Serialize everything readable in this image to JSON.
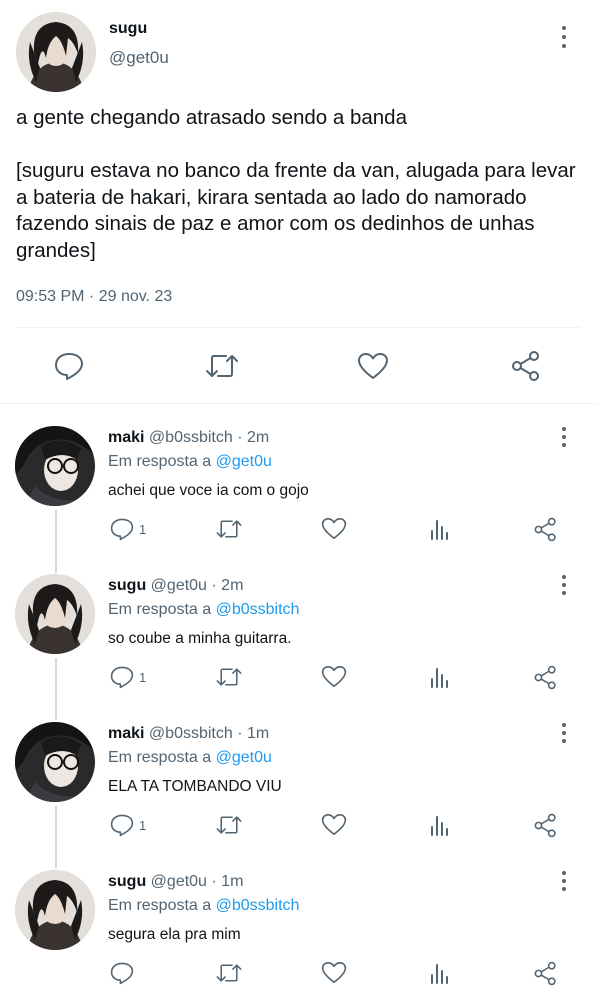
{
  "main_tweet": {
    "name": "sugu",
    "handle": "@get0u",
    "text": "a gente chegando atrasado sendo a banda\n\n[suguru estava no banco da frente da van, alugada para levar a bateria de hakari, kirara sentada ao lado do namorado fazendo sinais de paz e amor com os dedinhos de unhas grandes]",
    "timestamp": "09:53 PM · 29 nov. 23",
    "actions": [
      "reply-icon",
      "retweet-icon",
      "like-icon",
      "share-icon"
    ]
  },
  "replies": [
    {
      "name": "maki",
      "handle": "@b0ssbitch · 2m",
      "reply_prefix": "Em resposta a ",
      "reply_to": "@get0u",
      "text": "achei que voce ia com o gojo",
      "reply_count": "1"
    },
    {
      "name": "sugu",
      "handle": "@get0u · 2m",
      "reply_prefix": "Em resposta a ",
      "reply_to": "@b0ssbitch",
      "text": "so coube a minha guitarra.",
      "reply_count": "1"
    },
    {
      "name": "maki",
      "handle": "@b0ssbitch · 1m",
      "reply_prefix": "Em resposta a ",
      "reply_to": "@get0u",
      "text": "ELA TA TOMBANDO VIU",
      "reply_count": "1"
    },
    {
      "name": "sugu",
      "handle": "@get0u · 1m",
      "reply_prefix": "Em resposta a ",
      "reply_to": "@b0ssbitch",
      "text": "segura ela pra mim",
      "reply_count": ""
    }
  ],
  "colors": {
    "text": "#0f1419",
    "secondary": "#536471",
    "link": "#1d9bf0",
    "divider": "#eff3f4"
  }
}
